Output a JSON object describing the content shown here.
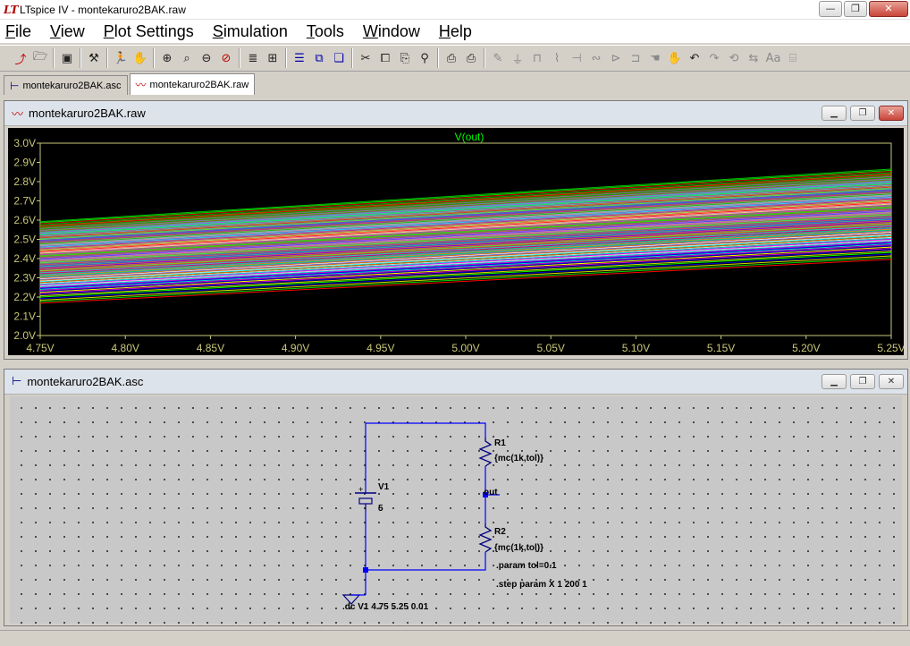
{
  "window": {
    "title": "LTspice IV - montekaruro2BAK.raw",
    "icon": "ltspice-logo-icon",
    "buttons": {
      "minimize": "—",
      "restore": "❐",
      "close": "✕"
    }
  },
  "menu": {
    "items": [
      {
        "label": "File",
        "u": "F",
        "rest": "ile"
      },
      {
        "label": "View",
        "u": "V",
        "rest": "iew"
      },
      {
        "label": "Plot Settings",
        "u": "P",
        "rest": "lot Settings"
      },
      {
        "label": "Simulation",
        "u": "S",
        "rest": "imulation"
      },
      {
        "label": "Tools",
        "u": "T",
        "rest": "ools"
      },
      {
        "label": "Window",
        "u": "W",
        "rest": "indow"
      },
      {
        "label": "Help",
        "u": "H",
        "rest": "elp"
      }
    ]
  },
  "toolbar": {
    "icons": [
      "new-plot-icon",
      "open-folder-icon",
      "save-icon",
      "control-panel-icon",
      "run-icon",
      "halt-hand-icon",
      "zoom-in-icon",
      "zoom-area-icon",
      "zoom-out-icon",
      "zoom-cancel-icon",
      "autorange-icon",
      "split-plot-icon",
      "tile-icon",
      "cascade-icon",
      "window-list-icon",
      "cut-icon",
      "copy-icon",
      "paste-icon",
      "find-icon",
      "print-preview-icon",
      "print-icon",
      "wire-icon",
      "ground-icon",
      "label-icon",
      "resistor-icon",
      "capacitor-icon",
      "inductor-icon",
      "diode-icon",
      "component-icon",
      "move-icon",
      "drag-icon",
      "undo-icon",
      "redo-icon",
      "rotate-icon",
      "mirror-icon",
      "text-icon",
      "spice-directive-icon"
    ]
  },
  "tabs": [
    {
      "label": "montekaruro2BAK.asc",
      "icon": "schematic-icon",
      "active": false
    },
    {
      "label": "montekaruro2BAK.raw",
      "icon": "waveform-icon",
      "active": true
    }
  ],
  "plot_window": {
    "title": "montekaruro2BAK.raw",
    "trace_label": "V(out)"
  },
  "schematic_window": {
    "title": "montekaruro2BAK.asc",
    "labels": {
      "v1": "V1",
      "v1_value": "5",
      "v1_plus": "+",
      "r1": "R1",
      "r1_value": "{mc(1k,tol)}",
      "r2": "R2",
      "r2_value": "{mc(1k,tol)}",
      "out": "out",
      "param": ".param tol=0.1",
      "step": ".step param X 1 200 1",
      "dc": ".dc V1 4.75 5.25 0.01"
    }
  },
  "chart_data": {
    "type": "line",
    "title": "V(out)",
    "xlabel": "",
    "ylabel": "",
    "xlim": [
      4.75,
      5.25
    ],
    "ylim": [
      2.0,
      3.0
    ],
    "x_ticks": [
      "4.75V",
      "4.80V",
      "4.85V",
      "4.90V",
      "4.95V",
      "5.00V",
      "5.05V",
      "5.10V",
      "5.15V",
      "5.20V",
      "5.25V"
    ],
    "y_ticks": [
      "3.0V",
      "2.9V",
      "2.8V",
      "2.7V",
      "2.6V",
      "2.5V",
      "2.4V",
      "2.3V",
      "2.2V",
      "2.1V",
      "2.0V"
    ],
    "grid": true,
    "background": "#000000",
    "axis_color": "#c8c87a",
    "trace_label_color": "#00ff00",
    "series_ratio": {
      "description_count": 200,
      "min_ratio": 0.4565,
      "max_ratio": 0.5455
    },
    "series": [
      {
        "x": [
          4.75,
          5.25
        ],
        "y": [
          2.168,
          2.396
        ],
        "color": "#ff0000"
      },
      {
        "x": [
          4.75,
          5.25
        ],
        "y": [
          2.2,
          2.432
        ],
        "color": "#00ff00"
      },
      {
        "x": [
          4.75,
          5.25
        ],
        "y": [
          2.225,
          2.46
        ],
        "color": "#ffff00"
      },
      {
        "x": [
          4.75,
          5.25
        ],
        "y": [
          2.245,
          2.482
        ],
        "color": "#0000ff"
      },
      {
        "x": [
          4.75,
          5.25
        ],
        "y": [
          2.262,
          2.5
        ],
        "color": "#ff00ff"
      },
      {
        "x": [
          4.75,
          5.25
        ],
        "y": [
          2.28,
          2.52
        ],
        "color": "#00ffff"
      },
      {
        "x": [
          4.75,
          5.25
        ],
        "y": [
          2.295,
          2.537
        ],
        "color": "#ffffff"
      },
      {
        "x": [
          4.75,
          5.25
        ],
        "y": [
          2.31,
          2.553
        ],
        "color": "#ff8000"
      },
      {
        "x": [
          4.75,
          5.25
        ],
        "y": [
          2.325,
          2.57
        ],
        "color": "#8080ff"
      },
      {
        "x": [
          4.75,
          5.25
        ],
        "y": [
          2.338,
          2.584
        ],
        "color": "#00ff80"
      },
      {
        "x": [
          4.75,
          5.25
        ],
        "y": [
          2.35,
          2.597
        ],
        "color": "#ff0080"
      },
      {
        "x": [
          4.75,
          5.25
        ],
        "y": [
          2.36,
          2.608
        ],
        "color": "#c0c000"
      },
      {
        "x": [
          4.75,
          5.25
        ],
        "y": [
          2.37,
          2.619
        ],
        "color": "#8000ff"
      },
      {
        "x": [
          4.75,
          5.25
        ],
        "y": [
          2.38,
          2.63
        ],
        "color": "#00c0c0"
      },
      {
        "x": [
          4.75,
          5.25
        ],
        "y": [
          2.39,
          2.641
        ],
        "color": "#ff4040"
      },
      {
        "x": [
          4.75,
          5.25
        ],
        "y": [
          2.398,
          2.65
        ],
        "color": "#40ff40"
      },
      {
        "x": [
          4.75,
          5.25
        ],
        "y": [
          2.406,
          2.659
        ],
        "color": "#ff40ff"
      },
      {
        "x": [
          4.75,
          5.25
        ],
        "y": [
          2.414,
          2.668
        ],
        "color": "#4040ff"
      },
      {
        "x": [
          4.75,
          5.25
        ],
        "y": [
          2.422,
          2.677
        ],
        "color": "#c08000"
      },
      {
        "x": [
          4.75,
          5.25
        ],
        "y": [
          2.43,
          2.686
        ],
        "color": "#00ff00"
      },
      {
        "x": [
          4.75,
          5.25
        ],
        "y": [
          2.438,
          2.695
        ],
        "color": "#ff00ff"
      },
      {
        "x": [
          4.75,
          5.25
        ],
        "y": [
          2.446,
          2.704
        ],
        "color": "#ffff80"
      },
      {
        "x": [
          4.75,
          5.25
        ],
        "y": [
          2.454,
          2.713
        ],
        "color": "#ff0000"
      },
      {
        "x": [
          4.75,
          5.25
        ],
        "y": [
          2.462,
          2.721
        ],
        "color": "#80ff80"
      },
      {
        "x": [
          4.75,
          5.25
        ],
        "y": [
          2.47,
          2.73
        ],
        "color": "#c000c0"
      },
      {
        "x": [
          4.75,
          5.25
        ],
        "y": [
          2.478,
          2.739
        ],
        "color": "#00ffff"
      },
      {
        "x": [
          4.75,
          5.25
        ],
        "y": [
          2.486,
          2.748
        ],
        "color": "#ff8080"
      },
      {
        "x": [
          4.75,
          5.25
        ],
        "y": [
          2.494,
          2.757
        ],
        "color": "#00c000"
      },
      {
        "x": [
          4.75,
          5.25
        ],
        "y": [
          2.502,
          2.766
        ],
        "color": "#ff00c0"
      },
      {
        "x": [
          4.75,
          5.25
        ],
        "y": [
          2.51,
          2.774
        ],
        "color": "#0080ff"
      },
      {
        "x": [
          4.75,
          5.25
        ],
        "y": [
          2.518,
          2.783
        ],
        "color": "#80ff00"
      },
      {
        "x": [
          4.75,
          5.25
        ],
        "y": [
          2.526,
          2.792
        ],
        "color": "#ff0040"
      },
      {
        "x": [
          4.75,
          5.25
        ],
        "y": [
          2.534,
          2.801
        ],
        "color": "#40c0ff"
      },
      {
        "x": [
          4.75,
          5.25
        ],
        "y": [
          2.545,
          2.813
        ],
        "color": "#00ff40"
      },
      {
        "x": [
          4.75,
          5.25
        ],
        "y": [
          2.556,
          2.826
        ],
        "color": "#c040ff"
      },
      {
        "x": [
          4.75,
          5.25
        ],
        "y": [
          2.57,
          2.841
        ],
        "color": "#808000"
      },
      {
        "x": [
          4.75,
          5.25
        ],
        "y": [
          2.592,
          2.865
        ],
        "color": "#00c000"
      }
    ]
  }
}
